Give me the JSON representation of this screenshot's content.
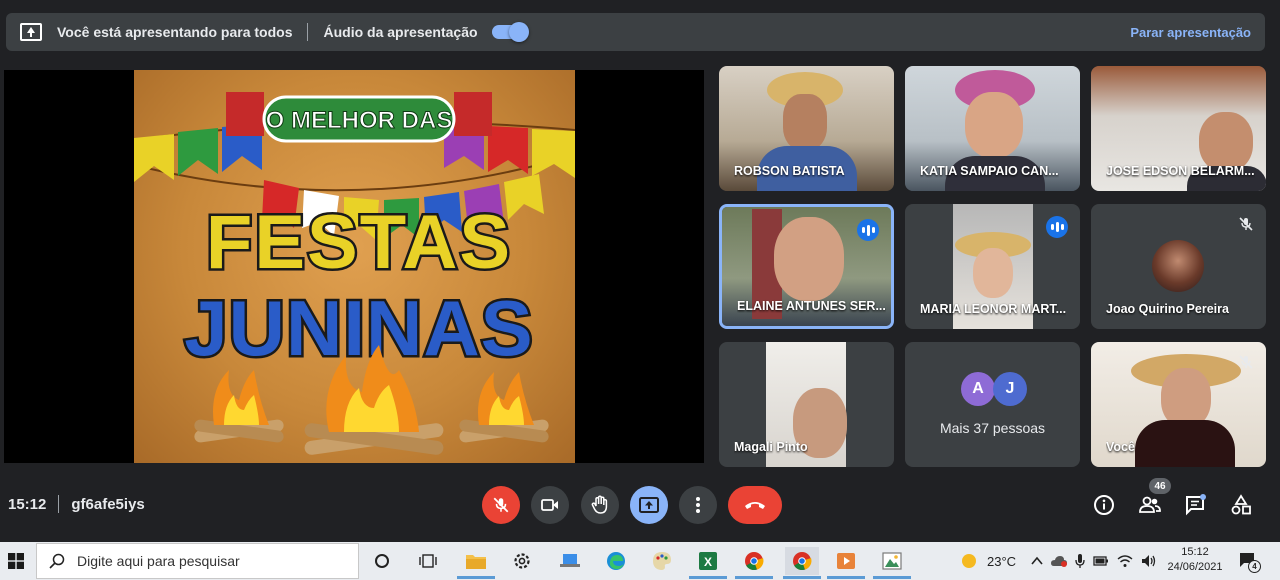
{
  "banner": {
    "presenting_text": "Você está apresentando para todos",
    "audio_label": "Áudio da apresentação",
    "audio_on": true,
    "stop_label": "Parar apresentação"
  },
  "slide": {
    "top_text": "O MELHOR DAS",
    "line1": "FESTAS",
    "line2": "JUNINAS"
  },
  "participants": [
    {
      "name": "ROBSON BATISTA",
      "status": "none"
    },
    {
      "name": "KATIA SAMPAIO CAN...",
      "status": "none"
    },
    {
      "name": "JOSE EDSON BELARM...",
      "status": "none"
    },
    {
      "name": "ELAINE ANTUNES SER...",
      "status": "speaking"
    },
    {
      "name": "MARIA LEONOR MART...",
      "status": "speaking"
    },
    {
      "name": "Joao Quirino Pereira",
      "status": "muted"
    },
    {
      "name": "Magali Pinto",
      "status": "none"
    },
    {
      "name": "Mais 37 pessoas",
      "initials": [
        "A",
        "J"
      ],
      "status": "none"
    },
    {
      "name": "Você",
      "status": "muted"
    }
  ],
  "meeting": {
    "time": "15:12",
    "code": "gf6afe5iys",
    "people_count": "46"
  },
  "taskbar": {
    "search_placeholder": "Digite aqui para pesquisar",
    "temperature": "23°C",
    "clock_time": "15:12",
    "clock_date": "24/06/2021",
    "notification_count": "4"
  },
  "colors": {
    "accent": "#8ab4f8",
    "danger": "#ea4335",
    "tile_bg": "#3c4043",
    "bg": "#202124"
  }
}
